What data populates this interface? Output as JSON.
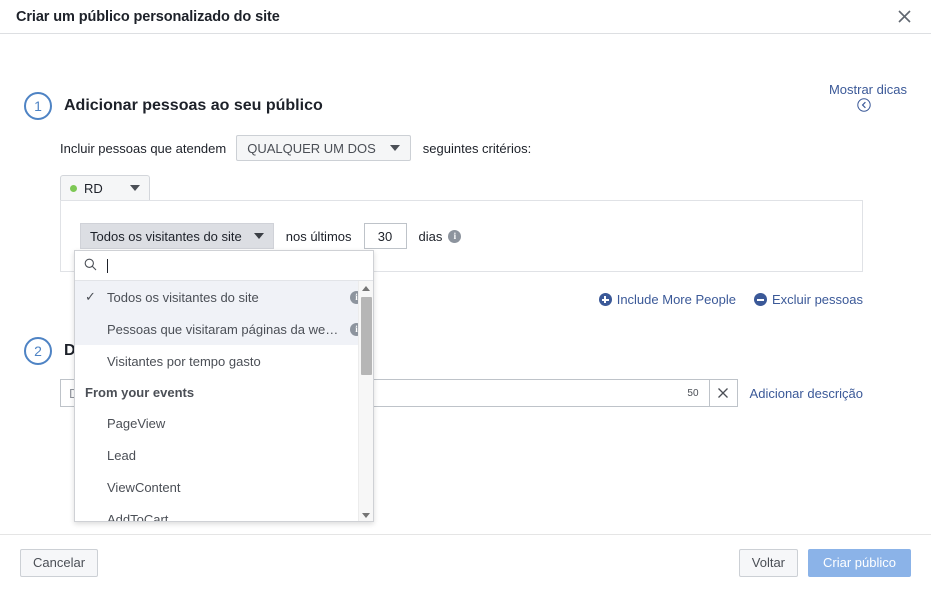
{
  "header": {
    "title": "Criar um público personalizado do site",
    "close_icon": "close-icon"
  },
  "tips": {
    "line1": "Mostrar",
    "line2": "dicas"
  },
  "step1": {
    "number": "1",
    "title": "Adicionar pessoas ao seu público",
    "criteria_prefix": "Incluir pessoas que atendem",
    "criteria_value": "QUALQUER UM DOS",
    "criteria_suffix": "seguintes critérios:",
    "tab_label": "RD",
    "rule_select_value": "Todos os visitantes do site",
    "rule_mid_label": "nos últimos",
    "rule_days_value": "30",
    "rule_days_label": "dias",
    "info_char": "i",
    "include_more": "Include More People",
    "exclude_people": "Excluir pessoas"
  },
  "step2": {
    "number": "2",
    "title": "Dê um nome ao seu público",
    "name_placeholder": "Dê um nome a esse público",
    "char_counter": "50",
    "clear_label": "×",
    "add_description": "Adicionar descrição"
  },
  "dropdown": {
    "search_value": "",
    "search_placeholder": "",
    "items": [
      {
        "label": "Todos os visitantes do site",
        "selected": true,
        "info": true
      },
      {
        "label": "Pessoas que visitaram páginas da we…",
        "selected": false,
        "info": true
      },
      {
        "label": "Visitantes por tempo gasto",
        "selected": false,
        "info": false
      }
    ],
    "group_label": "From your events",
    "events": [
      {
        "label": "PageView"
      },
      {
        "label": "Lead"
      },
      {
        "label": "ViewContent"
      },
      {
        "label": "AddToCart"
      }
    ]
  },
  "footer": {
    "cancel": "Cancelar",
    "back": "Voltar",
    "create": "Criar público"
  },
  "colors": {
    "link": "#3b5998",
    "step_circle": "#4e83c4",
    "green_dot": "#7dc855",
    "primary_disabled": "#8bb3e8"
  }
}
